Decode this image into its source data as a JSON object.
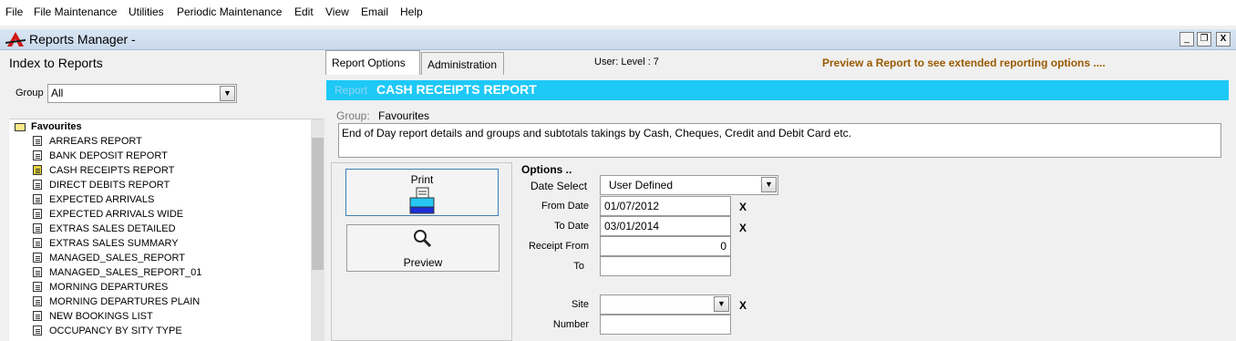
{
  "menu": [
    "File",
    "File Maintenance",
    "Utilities",
    "Periodic Maintenance",
    "Edit",
    "View",
    "Email",
    "Help"
  ],
  "window": {
    "title": "Reports Manager -",
    "minimize": "_",
    "restore": "❐",
    "close": "X"
  },
  "index": {
    "title": "Index to Reports",
    "group_label": "Group",
    "group_value": "All",
    "tree_root": "Favourites",
    "items": [
      "ARREARS REPORT",
      "BANK DEPOSIT REPORT",
      "CASH RECEIPTS REPORT",
      "DIRECT DEBITS REPORT",
      "EXPECTED ARRIVALS",
      "EXPECTED ARRIVALS WIDE",
      "EXTRAS SALES DETAILED",
      "EXTRAS SALES SUMMARY",
      "MANAGED_SALES_REPORT",
      "MANAGED_SALES_REPORT_01",
      "MORNING DEPARTURES",
      "MORNING DEPARTURES PLAIN",
      "NEW BOOKINGS LIST",
      "OCCUPANCY BY SITY TYPE"
    ],
    "selected_item": "CASH RECEIPTS REPORT"
  },
  "tabs": {
    "report_options": "Report Options",
    "administration": "Administration"
  },
  "user_info": "User:  Level :  7",
  "preview_hint": "Preview a Report to see extended reporting options ....",
  "report": {
    "label": "Report",
    "name": "CASH RECEIPTS REPORT",
    "group_label": "Group:",
    "group_value": "Favourites",
    "description": "End of Day report details and groups and subtotals takings by Cash, Cheques, Credit and Debit Card etc."
  },
  "actions": {
    "print": "Print",
    "preview": "Preview"
  },
  "options": {
    "heading": "Options ..",
    "date_select_label": "Date Select",
    "date_select_value": "User Defined",
    "from_date_label": "From Date",
    "from_date_value": "01/07/2012",
    "to_date_label": "To Date",
    "to_date_value": "03/01/2014",
    "receipt_from_label": "Receipt From",
    "receipt_from_value": "0",
    "to_label": "To",
    "to_value": "",
    "site_label": "Site",
    "site_value": "",
    "number_label": "Number",
    "number_value": "",
    "clear": "X"
  },
  "colors": {
    "report_bar": "#1ec8f7",
    "hint_text": "#9a5a00"
  }
}
